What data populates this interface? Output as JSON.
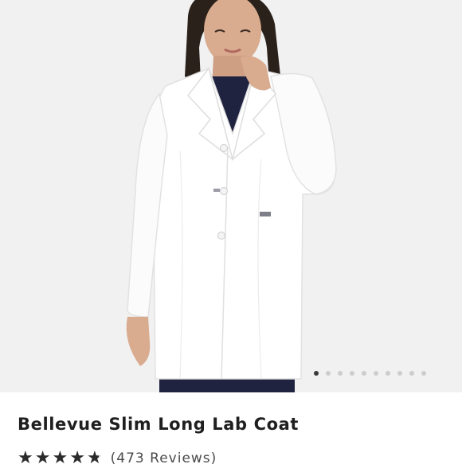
{
  "product": {
    "title": "Bellevue Slim Long Lab Coat",
    "rating": 4.75,
    "rating_max": 5,
    "reviews_label": "(473 Reviews)"
  },
  "gallery": {
    "total_images": 10,
    "active_index": 0,
    "image": "model-wearing-white-lab-coat"
  },
  "colors": {
    "coat": "#ffffff",
    "scrubs": "#1f2340",
    "background": "#f1f1f1",
    "dot_active": "#3a3a3a",
    "dot_inactive": "#cdcdcd"
  },
  "icons": {
    "star": "star-icon"
  }
}
